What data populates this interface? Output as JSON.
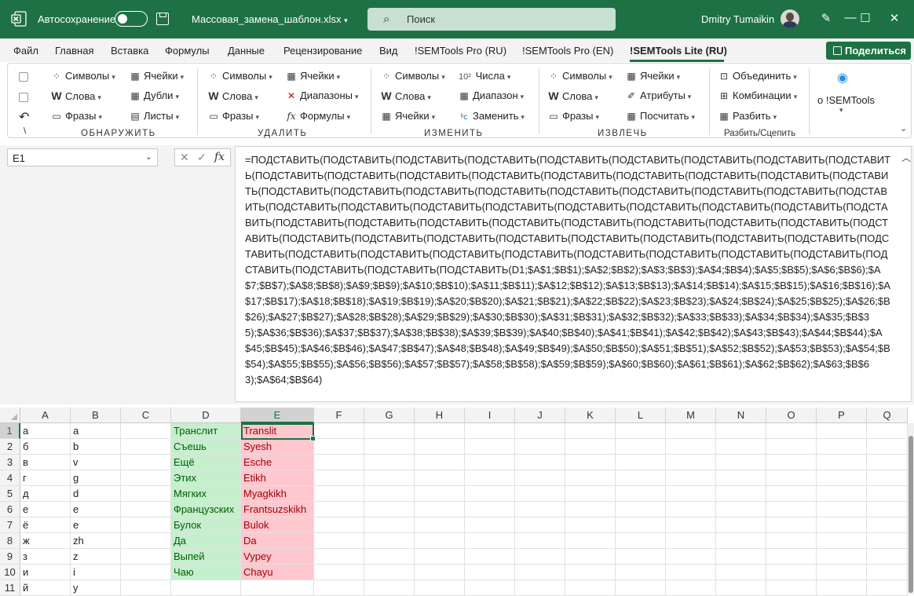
{
  "titlebar": {
    "autosave_label": "Автосохранение",
    "filename": "Массовая_замена_шаблон.xlsx",
    "search_placeholder": "Поиск",
    "user_name": "Dmitry Tumaikin",
    "accent_color": "#1e7145"
  },
  "menubar": {
    "tabs": [
      "Файл",
      "Главная",
      "Вставка",
      "Формулы",
      "Данные",
      "Рецензирование",
      "Вид",
      "!SEMTools Pro (RU)",
      "!SEMTools Pro (EN)",
      "!SEMTools Lite (RU)"
    ],
    "active_tab": "!SEMTools Lite (RU)",
    "share_label": "Поделиться"
  },
  "ribbon": {
    "detect": {
      "label": "ОБНАРУЖИТЬ",
      "items": [
        "Символы",
        "Слова",
        "Фразы",
        "Ячейки",
        "Дубли",
        "Листы"
      ],
      "extra": "\\"
    },
    "remove": {
      "label": "УДАЛИТЬ",
      "items": [
        "Символы",
        "Слова",
        "Фразы",
        "Ячейки",
        "Диапазоны",
        "Формулы"
      ]
    },
    "change": {
      "label": "ИЗМЕНИТЬ",
      "items": [
        "Символы",
        "Слова",
        "Ячейки",
        "Числа",
        "Диапазон",
        "Заменить"
      ]
    },
    "extract": {
      "label": "ИЗВЛЕЧЬ",
      "items": [
        "Символы",
        "Слова",
        "Фразы",
        "Ячейки",
        "Атрибуты",
        "Посчитать"
      ]
    },
    "split": {
      "label": "Разбить/Сцепить",
      "items": [
        "Объединить",
        "Комбинации",
        "Разбить"
      ]
    },
    "about_label": "о !SEMTools"
  },
  "formula_bar": {
    "name_box": "E1",
    "fx_label": "fx",
    "formula": "=ПОДСТАВИТЬ(ПОДСТАВИТЬ(ПОДСТАВИТЬ(ПОДСТАВИТЬ(ПОДСТАВИТЬ(ПОДСТАВИТЬ(ПОДСТАВИТЬ(ПОДСТАВИТЬ(ПОДСТАВИТЬ(ПОДСТАВИТЬ(ПОДСТАВИТЬ(ПОДСТАВИТЬ(ПОДСТАВИТЬ(ПОДСТАВИТЬ(ПОДСТАВИТЬ(ПОДСТАВИТЬ(ПОДСТАВИТЬ(ПОДСТАВИТЬ(ПОДСТАВИТЬ(ПОДСТАВИТЬ(ПОДСТАВИТЬ(ПОДСТАВИТЬ(ПОДСТАВИТЬ(ПОДСТАВИТЬ(ПОДСТАВИТЬ(ПОДСТАВИТЬ(ПОДСТАВИТЬ(ПОДСТАВИТЬ(ПОДСТАВИТЬ(ПОДСТАВИТЬ(ПОДСТАВИТЬ(ПОДСТАВИТЬ(ПОДСТАВИТЬ(ПОДСТАВИТЬ(ПОДСТАВИТЬ(ПОДСТАВИТЬ(ПОДСТАВИТЬ(ПОДСТАВИТЬ(ПОДСТАВИТЬ(ПОДСТАВИТЬ(ПОДСТАВИТЬ(ПОДСТАВИТЬ(ПОДСТАВИТЬ(ПОДСТАВИТЬ(ПОДСТАВИТЬ(ПОДСТАВИТЬ(ПОДСТАВИТЬ(ПОДСТАВИТЬ(ПОДСТАВИТЬ(ПОДСТАВИТЬ(ПОДСТАВИТЬ(ПОДСТАВИТЬ(ПОДСТАВИТЬ(ПОДСТАВИТЬ(ПОДСТАВИТЬ(ПОДСТАВИТЬ(ПОДСТАВИТЬ(ПОДСТАВИТЬ(ПОДСТАВИТЬ(ПОДСТАВИТЬ(ПОДСТАВИТЬ(ПОДСТАВИТЬ(ПОДСТАВИТЬ(ПОДСТАВИТЬ(ПОДСТАВИТЬ(ПОДСТАВИТЬ(D1;$A$1;$B$1);$A$2;$B$2);$A$3;$B$3);$A$4;$B$4);$A$5;$B$5);$A$6;$B$6);$A$7;$B$7);$A$8;$B$8);$A$9;$B$9);$A$10;$B$10);$A$11;$B$11);$A$12;$B$12);$A$13;$B$13);$A$14;$B$14);$A$15;$B$15);$A$16;$B$16);$A$17;$B$17);$A$18;$B$18);$A$19;$B$19);$A$20;$B$20);$A$21;$B$21);$A$22;$B$22);$A$23;$B$23);$A$24;$B$24);$A$25;$B$25);$A$26;$B$26);$A$27;$B$27);$A$28;$B$28);$A$29;$B$29);$A$30;$B$30);$A$31;$B$31);$A$32;$B$32);$A$33;$B$33);$A$34;$B$34);$A$35;$B$35);$A$36;$B$36);$A$37;$B$37);$A$38;$B$38);$A$39;$B$39);$A$40;$B$40);$A$41;$B$41);$A$42;$B$42);$A$43;$B$43);$A$44;$B$44);$A$45;$B$45);$A$46;$B$46);$A$47;$B$47);$A$48;$B$48);$A$49;$B$49);$A$50;$B$50);$A$51;$B$51);$A$52;$B$52);$A$53;$B$53);$A$54;$B$54);$A$55;$B$55);$A$56;$B$56);$A$57;$B$57);$A$58;$B$58);$A$59;$B$59);$A$60;$B$60);$A$61;$B$61);$A$62;$B$62);$A$63;$B$63);$A$64;$B$64)"
  },
  "sheet": {
    "columns": [
      "A",
      "B",
      "C",
      "D",
      "E",
      "F",
      "G",
      "H",
      "I",
      "J",
      "K",
      "L",
      "M",
      "N",
      "O",
      "P",
      "Q"
    ],
    "selected_column": "E",
    "selected_row": "1",
    "rows": [
      {
        "n": "1",
        "A": "а",
        "B": "a",
        "D": "Транслит",
        "E": "Translit"
      },
      {
        "n": "2",
        "A": "б",
        "B": "b",
        "D": "Съешь",
        "E": "Syesh"
      },
      {
        "n": "3",
        "A": "в",
        "B": "v",
        "D": "Ещё",
        "E": "Esche"
      },
      {
        "n": "4",
        "A": "г",
        "B": "g",
        "D": "Этих",
        "E": "Etikh"
      },
      {
        "n": "5",
        "A": "д",
        "B": "d",
        "D": "Мягких",
        "E": "Myagkikh"
      },
      {
        "n": "6",
        "A": "е",
        "B": "e",
        "D": "Французских",
        "E": "Frantsuzskikh"
      },
      {
        "n": "7",
        "A": "ё",
        "B": "e",
        "D": "Булок",
        "E": "Bulok"
      },
      {
        "n": "8",
        "A": "ж",
        "B": "zh",
        "D": "Да",
        "E": "Da"
      },
      {
        "n": "9",
        "A": "з",
        "B": "z",
        "D": "Выпей",
        "E": "Vypey"
      },
      {
        "n": "10",
        "A": "и",
        "B": "i",
        "D": "Чаю",
        "E": "Chayu"
      },
      {
        "n": "11",
        "A": "й",
        "B": "y",
        "D": "",
        "E": ""
      }
    ],
    "green_fill": "#c6efce",
    "red_fill": "#ffc7ce"
  }
}
